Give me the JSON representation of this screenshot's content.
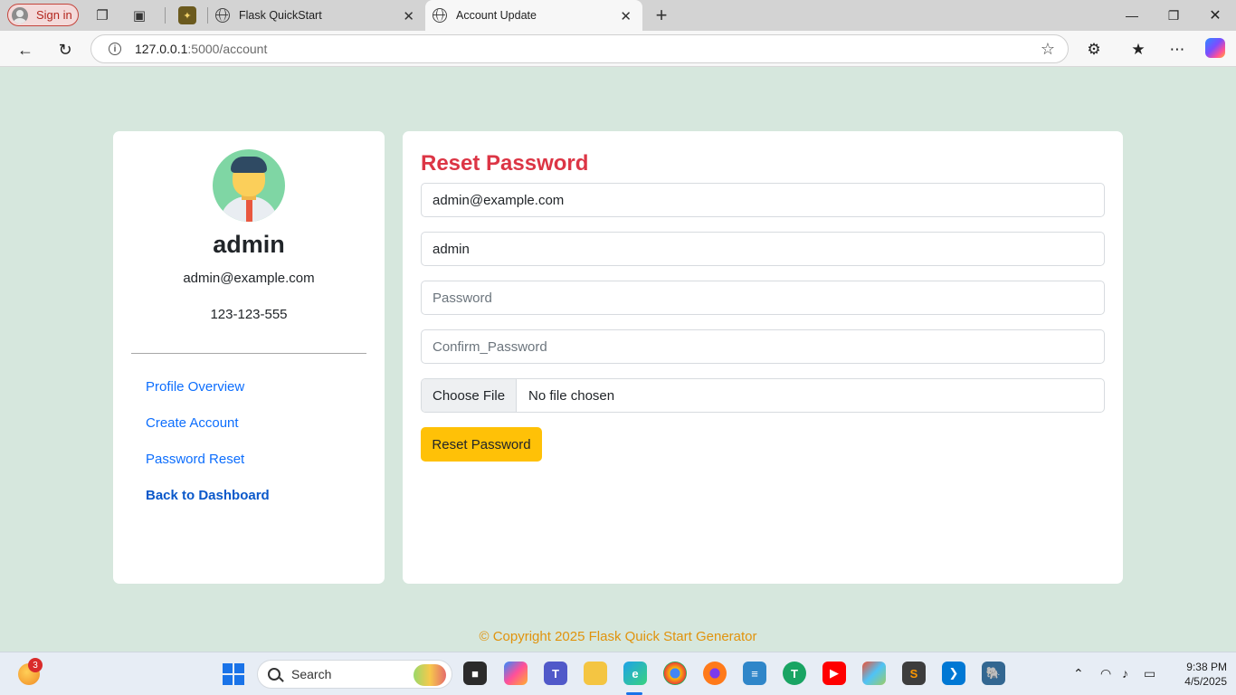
{
  "browser": {
    "signin_label": "Sign in",
    "tabs": [
      {
        "title": "Flask QuickStart",
        "active": false
      },
      {
        "title": "Account Update",
        "active": true
      }
    ],
    "url_host": "127.0.0.1",
    "url_path": ":5000/account"
  },
  "profile": {
    "name": "admin",
    "email": "admin@example.com",
    "phone": "123-123-555",
    "links": [
      {
        "label": "Profile Overview"
      },
      {
        "label": "Create Account"
      },
      {
        "label": "Password Reset"
      },
      {
        "label": "Back to Dashboard"
      }
    ]
  },
  "form": {
    "title": "Reset Password",
    "email_value": "admin@example.com",
    "username_value": "admin",
    "password_placeholder": "Password",
    "confirm_placeholder": "Confirm_Password",
    "file_button": "Choose File",
    "file_status": "No file chosen",
    "submit_label": "Reset Password"
  },
  "footer": {
    "text": "© Copyright 2025 Flask Quick Start Generator"
  },
  "taskbar": {
    "weather_badge": "3",
    "search_placeholder": "Search",
    "time": "9:38 PM",
    "date": "4/5/2025"
  },
  "colors": {
    "page_bg": "#d6e7dd",
    "title_red": "#dc3545",
    "link_blue": "#0d6efd",
    "button_yellow": "#ffc107",
    "footer_orange": "#e0930d"
  }
}
